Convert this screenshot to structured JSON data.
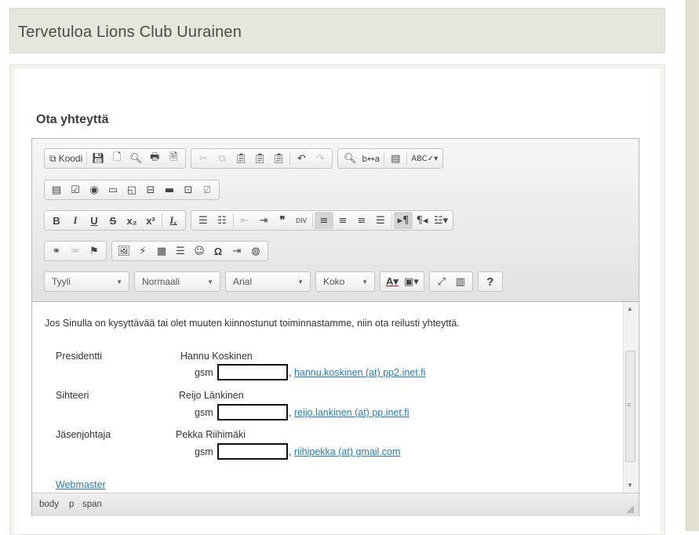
{
  "header": {
    "title": "Tervetuloa Lions Club Uurainen"
  },
  "section": {
    "heading": "Ota yhteyttä"
  },
  "toolbar": {
    "source_label": "Koodi",
    "style_combo": "Tyyli",
    "format_combo": "Normaali",
    "font_combo": "Arial",
    "size_combo": "Koko",
    "help_label": "?"
  },
  "content": {
    "intro": "Jos Sinulla on kysyttävää tai olet muuten kiinnostunut toiminnastamme, niin ota reilusti yhteyttä.",
    "gsm_label": "gsm",
    "contacts": [
      {
        "role": "Presidentti",
        "name": "Hannu Koskinen",
        "email": "hannu.koskinen (at) pp2.inet.fi"
      },
      {
        "role": "Sihteeri",
        "name": "Reijo Länkinen",
        "email": "reijo.lankinen (at) pp.inet.fi"
      },
      {
        "role": "Jäsenjohtaja",
        "name": "Pekka Riihimäki",
        "email": "riihipekka (at) gmail.com"
      }
    ],
    "webmaster": "Webmaster"
  },
  "status": {
    "path": [
      "body",
      "p",
      "span"
    ]
  }
}
